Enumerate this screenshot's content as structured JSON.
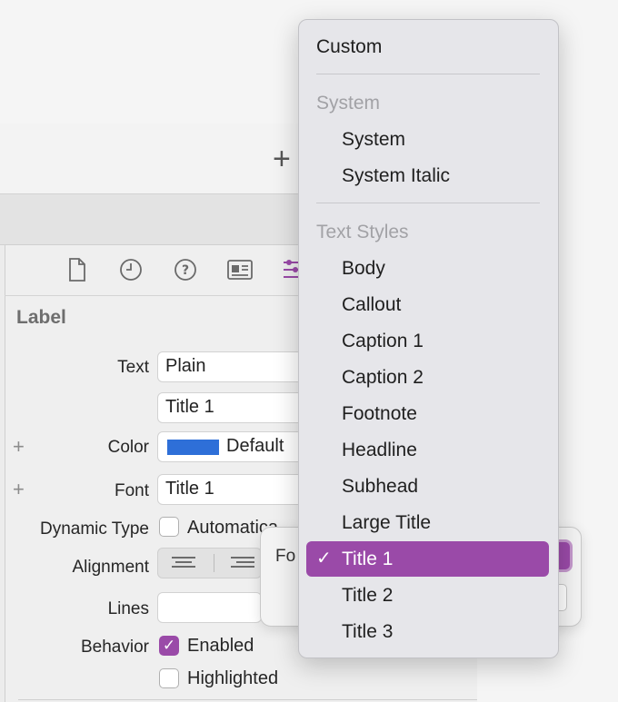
{
  "inspector": {
    "section_title": "Label",
    "text_label": "Text",
    "text_value": "Plain",
    "title_value": "Title 1",
    "color_label": "Color",
    "color_value": "Default",
    "color_swatch": "#2e6fd8",
    "font_label": "Font",
    "font_value": "Title 1",
    "dynamic_type_label": "Dynamic Type",
    "dynamic_type_value": "Automatica",
    "alignment_label": "Alignment",
    "lines_label": "Lines",
    "behavior_label": "Behavior",
    "enabled_label": "Enabled",
    "highlighted_label": "Highlighted",
    "tab_icons": [
      "file-icon",
      "history-icon",
      "help-icon",
      "identity-icon",
      "attributes-icon"
    ]
  },
  "popover": {
    "label": "Fo"
  },
  "menu": {
    "custom": "Custom",
    "system_header": "System",
    "system_items": [
      "System",
      "System Italic"
    ],
    "text_styles_header": "Text Styles",
    "text_styles": [
      "Body",
      "Callout",
      "Caption 1",
      "Caption 2",
      "Footnote",
      "Headline",
      "Subhead",
      "Large Title",
      "Title 1",
      "Title 2",
      "Title 3"
    ],
    "selected": "Title 1",
    "accent": "#9a4aa8"
  }
}
